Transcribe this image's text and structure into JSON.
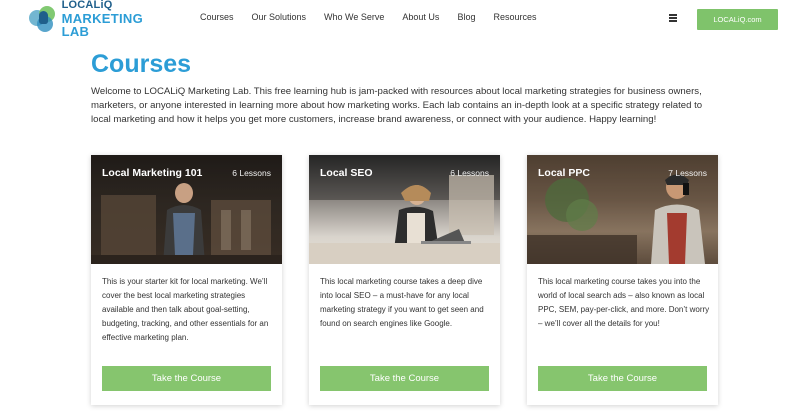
{
  "header": {
    "logo_top": "LOCALiQ",
    "logo_bottom": "MARKETING LAB",
    "nav": [
      "Courses",
      "Our Solutions",
      "Who We Serve",
      "About Us",
      "Blog",
      "Resources"
    ],
    "cta_label": "LOCALiQ.com",
    "accent_color": "#7fc36b"
  },
  "main": {
    "title": "Courses",
    "title_color": "#2c9dd6",
    "intro": "Welcome to LOCALiQ Marketing Lab. This free learning hub is jam-packed with resources about local marketing strategies for business owners, marketers, or anyone interested in learning more about how marketing works. Each lab contains an in-depth look at a specific strategy related to local marketing and how it helps you get more customers, increase brand awareness, or connect with your audience. Happy learning!"
  },
  "cards": [
    {
      "title": "Local Marketing 101",
      "lessons": "6 Lessons",
      "text": "This is your starter kit for local marketing. We’ll cover the best local marketing strategies available and then talk about goal-setting, budgeting, tracking, and other essentials for an effective marketing plan.",
      "button": "Take the Course"
    },
    {
      "title": "Local SEO",
      "lessons": "6 Lessons",
      "text": "This local marketing course takes a deep dive into local SEO – a must-have for any local marketing strategy if you want to get seen and found on search engines like Google.",
      "button": "Take the Course"
    },
    {
      "title": "Local PPC",
      "lessons": "7 Lessons",
      "text": "This local marketing course takes you into the world of local search ads – also known as local PPC, SEM, pay-per-click, and more. Don’t worry – we’ll cover all the details for you!",
      "button": "Take the Course"
    }
  ]
}
